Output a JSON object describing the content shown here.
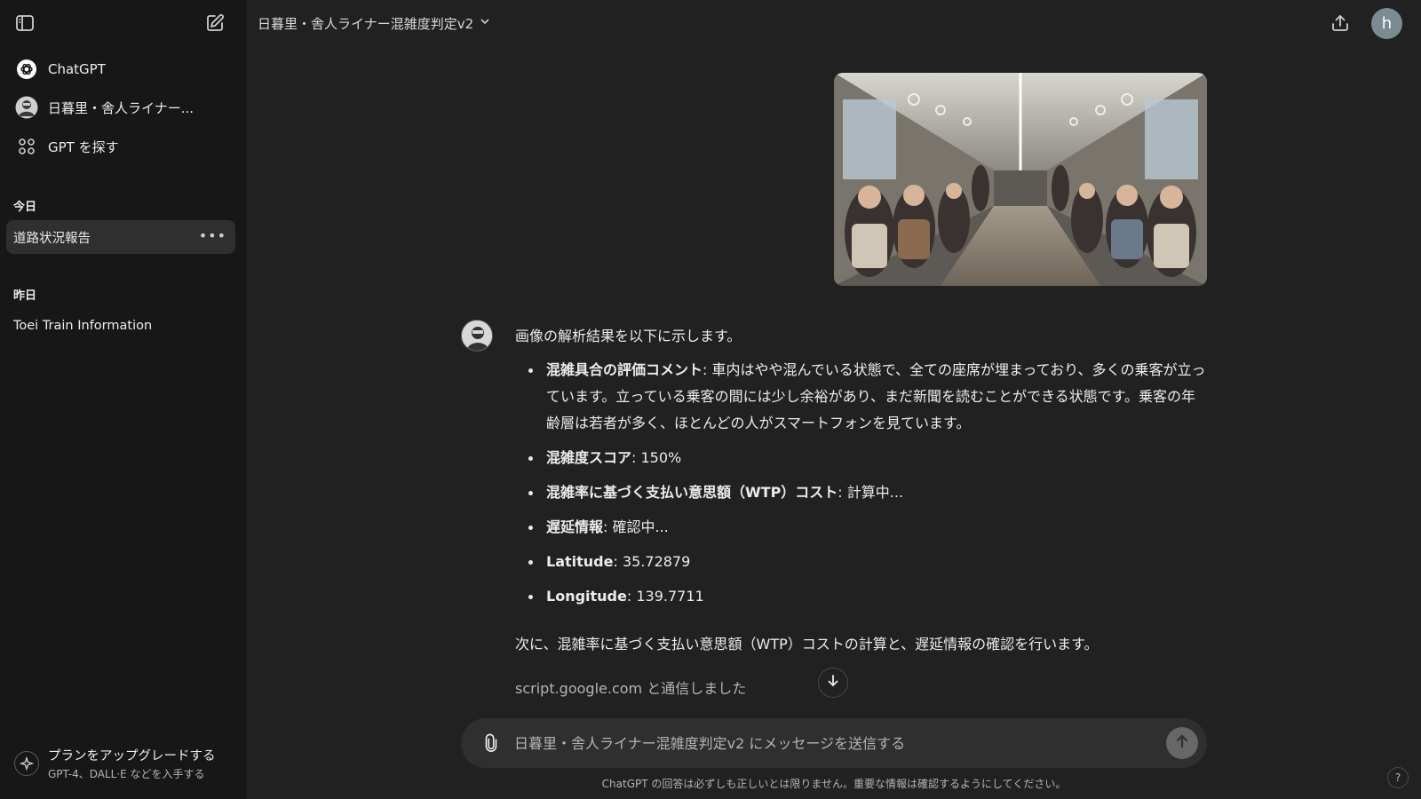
{
  "sidebar": {
    "items": [
      {
        "label": "ChatGPT",
        "icon": "openai-logo-icon"
      },
      {
        "label": "日暮里・舎人ライナー...",
        "icon": "gpt-avatar-icon"
      },
      {
        "label": "GPT を探す",
        "icon": "grid-icon"
      }
    ],
    "sections": [
      {
        "title": "今日",
        "conversations": [
          "道路状況報告"
        ]
      },
      {
        "title": "昨日",
        "conversations": [
          "Toei Train Information"
        ]
      }
    ],
    "upgrade": {
      "title": "プランをアップグレードする",
      "subtitle": "GPT-4、DALL·E などを入手する"
    }
  },
  "header": {
    "title": "日暮里・舎人ライナー混雑度判定v2",
    "avatar_initial": "h"
  },
  "chat": {
    "intro": "画像の解析結果を以下に示します。",
    "bullets": [
      {
        "label": "混雑具合の評価コメント",
        "text": ": 車内はやや混んでいる状態で、全ての座席が埋まっており、多くの乗客が立っています。立っている乗客の間には少し余裕があり、まだ新聞を読むことができる状態です。乗客の年齢層は若者が多く、ほとんどの人がスマートフォンを見ています。"
      },
      {
        "label": "混雑度スコア",
        "text": ": 150%"
      },
      {
        "label": "混雑率に基づく支払い意思額（WTP）コスト",
        "text": ": 計算中..."
      },
      {
        "label": "遅延情報",
        "text": ": 確認中..."
      },
      {
        "label": "Latitude",
        "text": ": 35.72879"
      },
      {
        "label": "Longitude",
        "text": ": 139.7711"
      }
    ],
    "followup": "次に、混雑率に基づく支払い意思額（WTP）コストの計算と、遅延情報の確認を行います。",
    "tool_note": "script.google.com と通信しました"
  },
  "composer": {
    "placeholder": "日暮里・舎人ライナー混雑度判定v2 にメッセージを送信する"
  },
  "footer": {
    "disclaimer": "ChatGPT の回答は必ずしも正しいとは限りません。重要な情報は確認するようにしてください。",
    "help": "?"
  },
  "colors": {
    "background": "#212121",
    "sidebar": "#171717",
    "composer": "#2f2f2f",
    "avatar": "#7b8b93"
  }
}
